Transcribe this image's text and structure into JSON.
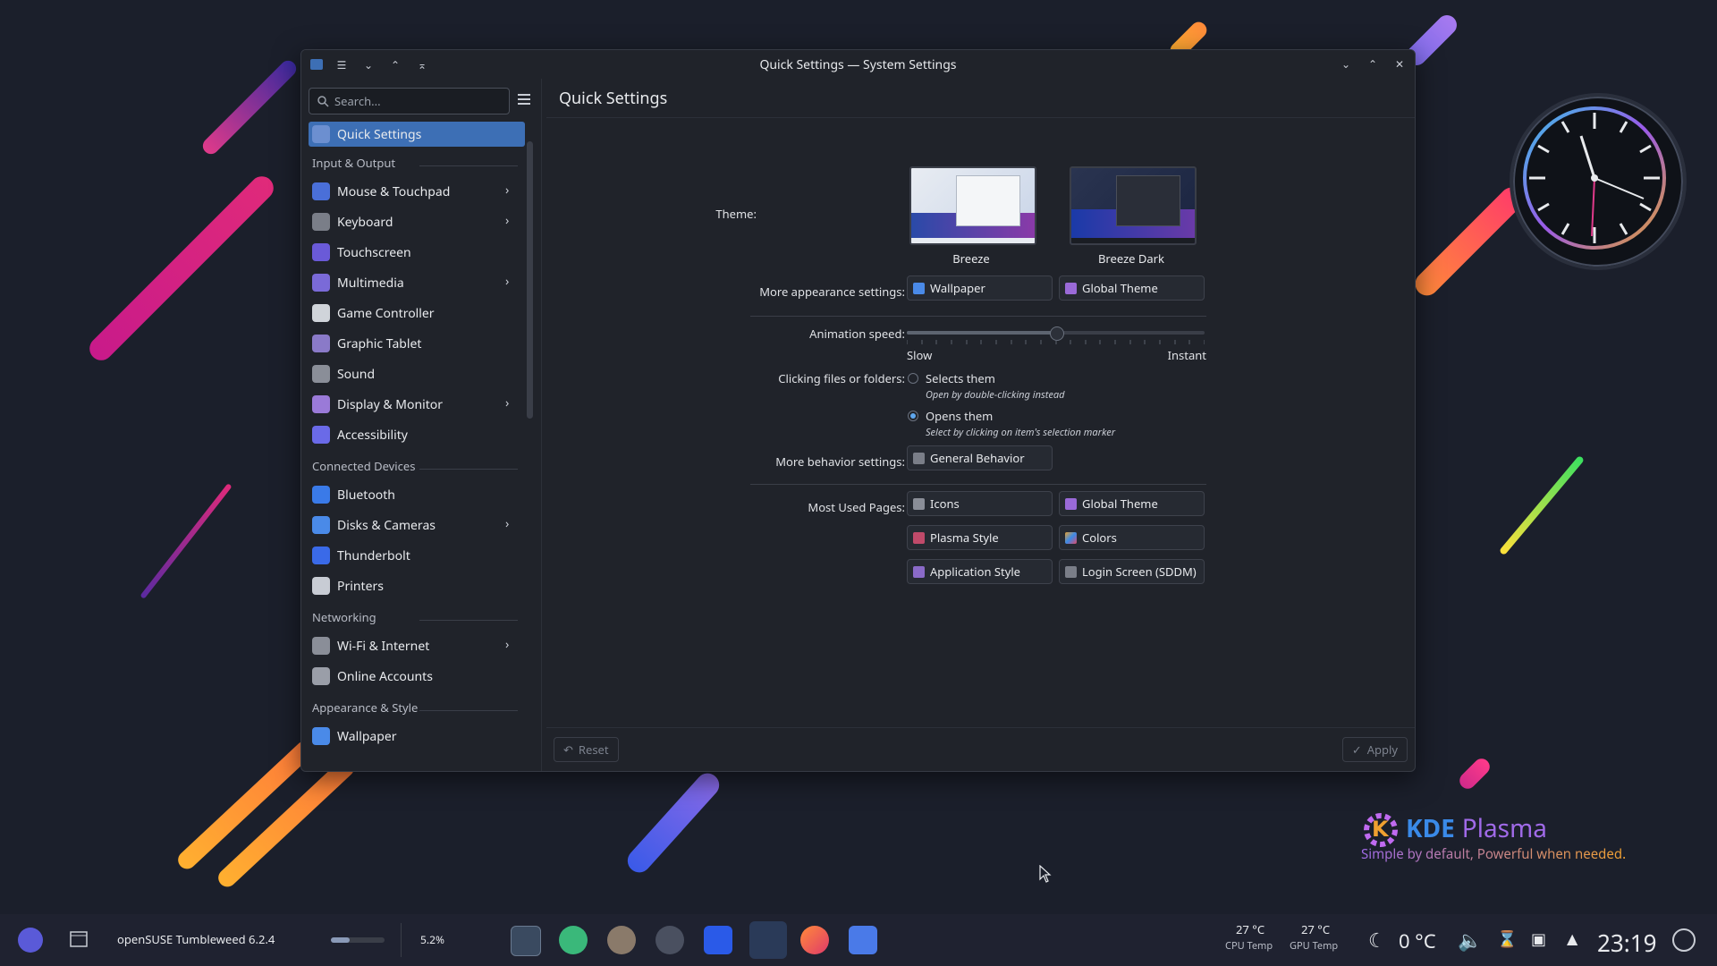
{
  "window": {
    "title": "Quick Settings — System Settings",
    "search_placeholder": "Search...",
    "page_title": "Quick Settings"
  },
  "sidebar": {
    "selected": "Quick Settings",
    "items": [
      {
        "label": "Quick Settings",
        "icon": "quick-settings-icon",
        "color": "#6c8fd0"
      },
      {
        "category": "Input & Output"
      },
      {
        "label": "Mouse & Touchpad",
        "icon": "mouse-icon",
        "color": "#4a6fd8",
        "arrow": true
      },
      {
        "label": "Keyboard",
        "icon": "keyboard-icon",
        "color": "#7a7e88",
        "arrow": true
      },
      {
        "label": "Touchscreen",
        "icon": "touchscreen-icon",
        "color": "#6a5ad8"
      },
      {
        "label": "Multimedia",
        "icon": "multimedia-icon",
        "color": "#7a6ad8",
        "arrow": true
      },
      {
        "label": "Game Controller",
        "icon": "game-controller-icon",
        "color": "#d0d4da"
      },
      {
        "label": "Graphic Tablet",
        "icon": "graphic-tablet-icon",
        "color": "#8a7ac8"
      },
      {
        "label": "Sound",
        "icon": "sound-icon",
        "color": "#8a8e98"
      },
      {
        "label": "Display & Monitor",
        "icon": "display-icon",
        "color": "#9a7ad8",
        "arrow": true
      },
      {
        "label": "Accessibility",
        "icon": "accessibility-icon",
        "color": "#6a6ae8"
      },
      {
        "category": "Connected Devices"
      },
      {
        "label": "Bluetooth",
        "icon": "bluetooth-icon",
        "color": "#3a7ae8"
      },
      {
        "label": "Disks & Cameras",
        "icon": "disks-icon",
        "color": "#4a8ae8",
        "arrow": true
      },
      {
        "label": "Thunderbolt",
        "icon": "thunderbolt-icon",
        "color": "#3a6ae8"
      },
      {
        "label": "Printers",
        "icon": "printer-icon",
        "color": "#c8ccd4"
      },
      {
        "category": "Networking"
      },
      {
        "label": "Wi-Fi & Internet",
        "icon": "wifi-icon",
        "color": "#8a8e98",
        "arrow": true
      },
      {
        "label": "Online Accounts",
        "icon": "online-accounts-icon",
        "color": "#9a9ea8"
      },
      {
        "category": "Appearance & Style"
      },
      {
        "label": "Wallpaper",
        "icon": "wallpaper-icon",
        "color": "#4a8ae8"
      }
    ]
  },
  "settings": {
    "theme_label": "Theme:",
    "theme_options": [
      "Breeze",
      "Breeze Dark"
    ],
    "more_appearance_label": "More appearance settings:",
    "appearance_buttons": [
      "Wallpaper",
      "Global Theme"
    ],
    "animation_label": "Animation speed:",
    "animation_value": 0.5,
    "slow_label": "Slow",
    "instant_label": "Instant",
    "clicking_label": "Clicking files or folders:",
    "option_select": "Selects them",
    "option_select_hint": "Open by double-clicking instead",
    "option_open": "Opens them",
    "option_open_hint": "Select by clicking on item's selection marker",
    "more_behavior_label": "More behavior settings:",
    "behavior_button": "General Behavior",
    "most_used_label": "Most Used Pages:",
    "most_used": [
      "Icons",
      "Global Theme",
      "Plasma Style",
      "Colors",
      "Application Style",
      "Login Screen (SDDM)"
    ]
  },
  "footer": {
    "reset": "Reset",
    "apply": "Apply"
  },
  "taskbar": {
    "distro": "openSUSE Tumbleweed 6.2.4",
    "cpu_load": "5.2%",
    "cpu_temp": "27 °C",
    "cpu_temp_label": "CPU Temp",
    "gpu_temp": "27 °C",
    "gpu_temp_label": "GPU Temp",
    "weather": "0 °C",
    "time": "23:19"
  },
  "branding": {
    "kde": "KDE",
    "plasma": "Plasma",
    "tagline": "Simple by default, Powerful when needed."
  }
}
